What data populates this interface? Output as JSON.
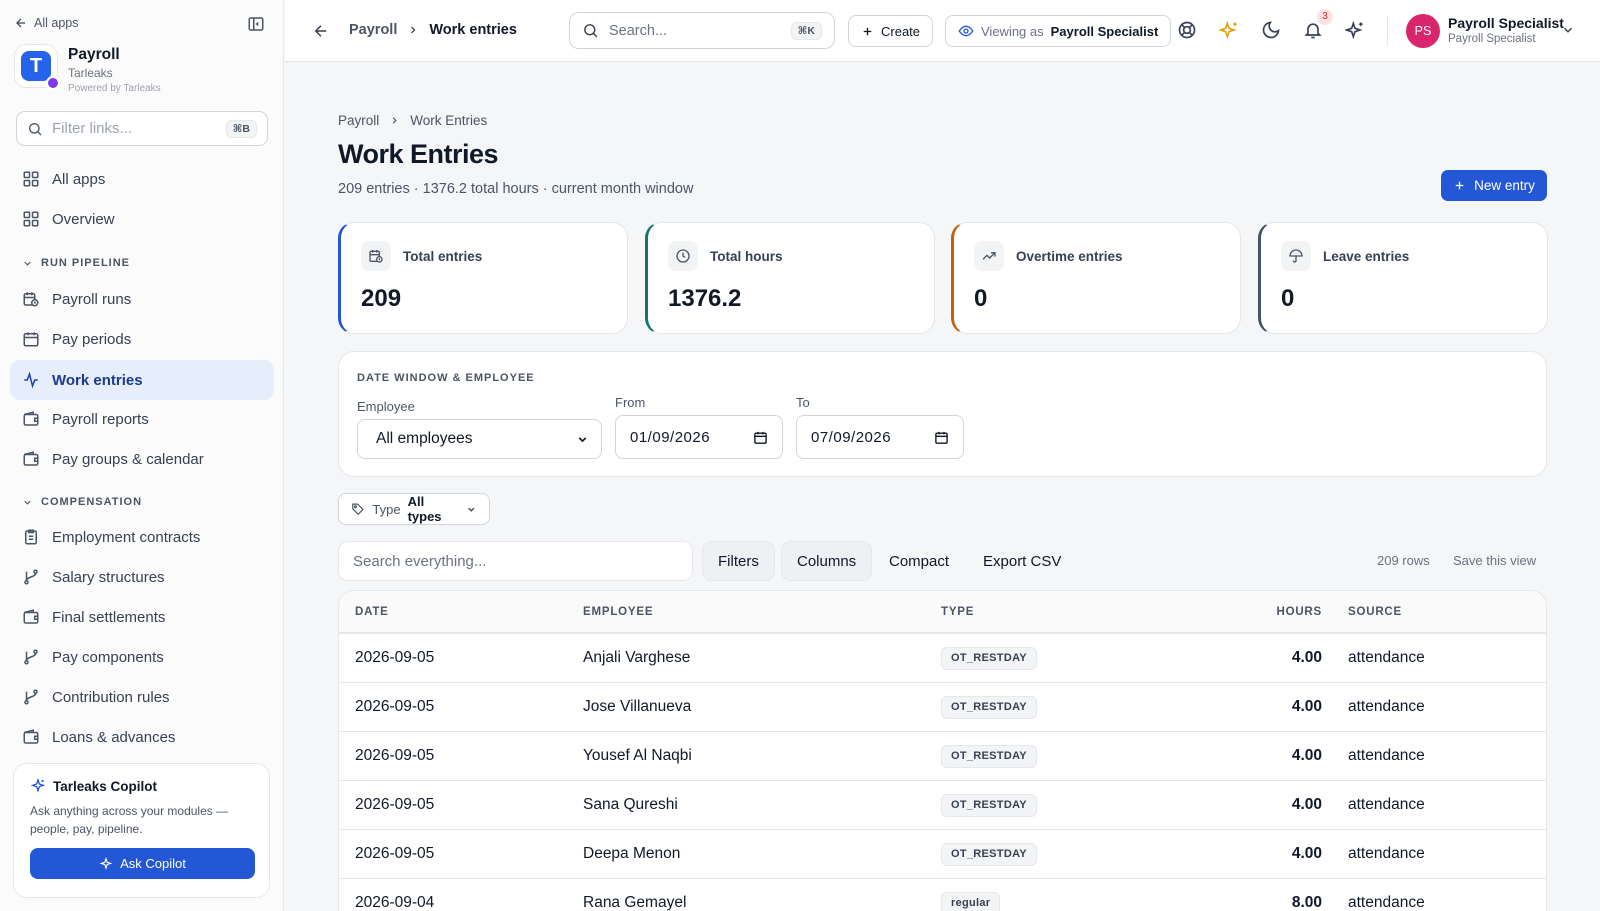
{
  "sidebar": {
    "all_apps": "All apps",
    "app_name": "Payroll",
    "org": "Tarleaks",
    "powered": "Powered by Tarleaks",
    "filter_placeholder": "Filter links...",
    "filter_shortcut": "⌘B",
    "top_items": [
      {
        "label": "All apps",
        "icon": "grid-icon"
      },
      {
        "label": "Overview",
        "icon": "grid-icon"
      }
    ],
    "sections": [
      {
        "label": "RUN PIPELINE",
        "items": [
          {
            "label": "Payroll runs",
            "icon": "calendar-clock-icon"
          },
          {
            "label": "Pay periods",
            "icon": "calendar-icon"
          },
          {
            "label": "Work entries",
            "icon": "activity-icon",
            "active": true
          },
          {
            "label": "Payroll reports",
            "icon": "wallet-icon"
          },
          {
            "label": "Pay groups & calendar",
            "icon": "wallet-icon"
          }
        ]
      },
      {
        "label": "COMPENSATION",
        "items": [
          {
            "label": "Employment contracts",
            "icon": "clipboard-icon"
          },
          {
            "label": "Salary structures",
            "icon": "branch-icon"
          },
          {
            "label": "Final settlements",
            "icon": "wallet-icon"
          },
          {
            "label": "Pay components",
            "icon": "branch-icon"
          },
          {
            "label": "Contribution rules",
            "icon": "branch-icon"
          },
          {
            "label": "Loans & advances",
            "icon": "wallet-icon"
          }
        ]
      }
    ],
    "copilot": {
      "title": "Tarleaks Copilot",
      "desc": "Ask anything across your modules — people, pay, pipeline.",
      "button": "Ask Copilot"
    }
  },
  "topbar": {
    "crumb_parent": "Payroll",
    "crumb_current": "Work entries",
    "search_placeholder": "Search...",
    "search_shortcut": "⌘K",
    "create": "Create",
    "viewing_as_label": "Viewing as",
    "viewing_as_role": "Payroll Specialist",
    "notifications_count": "3",
    "user": {
      "initials": "PS",
      "name": "Payroll Specialist",
      "role": "Payroll Specialist"
    }
  },
  "page": {
    "breadcrumb": [
      "Payroll",
      "Work Entries"
    ],
    "title": "Work Entries",
    "subtitle": "209 entries · 1376.2 total hours · current month window",
    "new_entry": "New entry"
  },
  "stats": [
    {
      "label": "Total entries",
      "value": "209",
      "icon": "calendar-clock-icon",
      "accent": "#2457d6"
    },
    {
      "label": "Total hours",
      "value": "1376.2",
      "icon": "clock-icon",
      "accent": "#0f766e"
    },
    {
      "label": "Overtime entries",
      "value": "0",
      "icon": "trend-up-icon",
      "accent": "#c2610c"
    },
    {
      "label": "Leave entries",
      "value": "0",
      "icon": "umbrella-icon",
      "accent": "#475569"
    }
  ],
  "filters": {
    "title": "DATE WINDOW & EMPLOYEE",
    "employee_label": "Employee",
    "employee_value": "All employees",
    "from_label": "From",
    "from_value": "01/09/2026",
    "to_label": "To",
    "to_value": "07/09/2026",
    "type_label": "Type",
    "type_value": "All types"
  },
  "toolbar": {
    "search_placeholder": "Search everything...",
    "filters": "Filters",
    "columns": "Columns",
    "compact": "Compact",
    "export": "Export CSV",
    "rows": "209 rows",
    "save_view": "Save this view"
  },
  "table": {
    "columns": [
      "DATE",
      "EMPLOYEE",
      "TYPE",
      "HOURS",
      "SOURCE"
    ],
    "rows": [
      {
        "date": "2026-09-05",
        "employee": "Anjali Varghese",
        "type": "OT_RESTDAY",
        "hours": "4.00",
        "source": "attendance"
      },
      {
        "date": "2026-09-05",
        "employee": "Jose Villanueva",
        "type": "OT_RESTDAY",
        "hours": "4.00",
        "source": "attendance"
      },
      {
        "date": "2026-09-05",
        "employee": "Yousef Al Naqbi",
        "type": "OT_RESTDAY",
        "hours": "4.00",
        "source": "attendance"
      },
      {
        "date": "2026-09-05",
        "employee": "Sana Qureshi",
        "type": "OT_RESTDAY",
        "hours": "4.00",
        "source": "attendance"
      },
      {
        "date": "2026-09-05",
        "employee": "Deepa Menon",
        "type": "OT_RESTDAY",
        "hours": "4.00",
        "source": "attendance"
      },
      {
        "date": "2026-09-04",
        "employee": "Rana Gemayel",
        "type": "regular",
        "hours": "8.00",
        "source": "attendance"
      }
    ]
  }
}
